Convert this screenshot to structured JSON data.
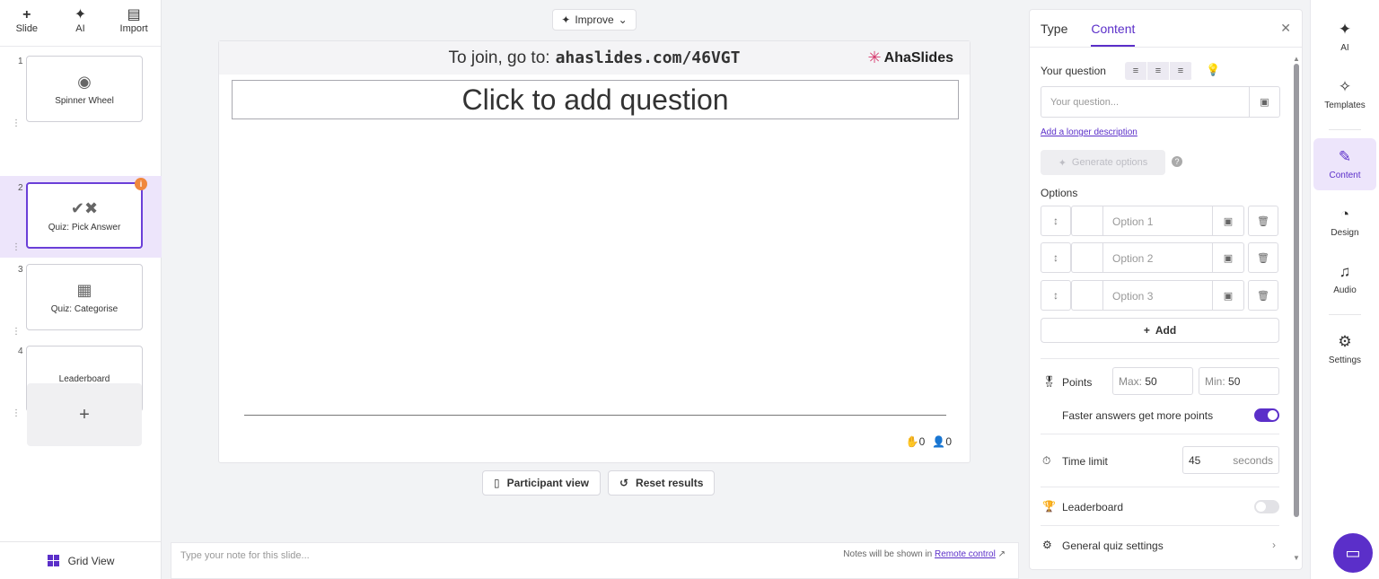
{
  "toolbar": {
    "slide_label": "Slide",
    "ai_label": "AI",
    "import_label": "Import"
  },
  "slides": [
    {
      "num": "1",
      "title": "Spinner Wheel",
      "icon": "spinner-icon"
    },
    {
      "num": "2",
      "title": "Quiz: Pick Answer",
      "icon": "check-cross-icon",
      "active": true,
      "badge": "i"
    },
    {
      "num": "3",
      "title": "Quiz: Categorise",
      "icon": "categorise-icon"
    },
    {
      "num": "4",
      "title": "Leaderboard",
      "icon": ""
    }
  ],
  "grid_view_label": "Grid View",
  "improve_label": "Improve",
  "canvas": {
    "join_prefix": "To join, go to:",
    "join_url": "ahaslides.com/46VGT",
    "logo": "AhaSlides",
    "question_placeholder": "Click to add question",
    "hand_count": "0",
    "participant_count": "0"
  },
  "buttons": {
    "participant_view": "Participant view",
    "reset_results": "Reset results"
  },
  "notes": {
    "placeholder": "Type your note for this slide...",
    "remote_prefix": "Notes will be shown in",
    "remote_link": "Remote control"
  },
  "panel": {
    "tab_type": "Type",
    "tab_content": "Content",
    "your_question_label": "Your question",
    "question_placeholder": "Your question...",
    "longer_description": "Add a longer description",
    "generate_options": "Generate options",
    "options_label": "Options",
    "options": [
      "Option 1",
      "Option 2",
      "Option 3"
    ],
    "add_label": "Add",
    "points_label": "Points",
    "max_prefix": "Max:",
    "max_value": "50",
    "min_prefix": "Min:",
    "min_value": "50",
    "faster_label": "Faster answers get more points",
    "faster_on": true,
    "time_limit_label": "Time limit",
    "time_value": "45",
    "time_unit": "seconds",
    "leaderboard_label": "Leaderboard",
    "leaderboard_on": false,
    "general_settings_label": "General quiz settings"
  },
  "rail": {
    "ai": "AI",
    "templates": "Templates",
    "content": "Content",
    "design": "Design",
    "audio": "Audio",
    "settings": "Settings"
  },
  "colors": {
    "accent": "#5b2fc9",
    "active_bg": "#ede5fb",
    "badge": "#f0883e"
  }
}
